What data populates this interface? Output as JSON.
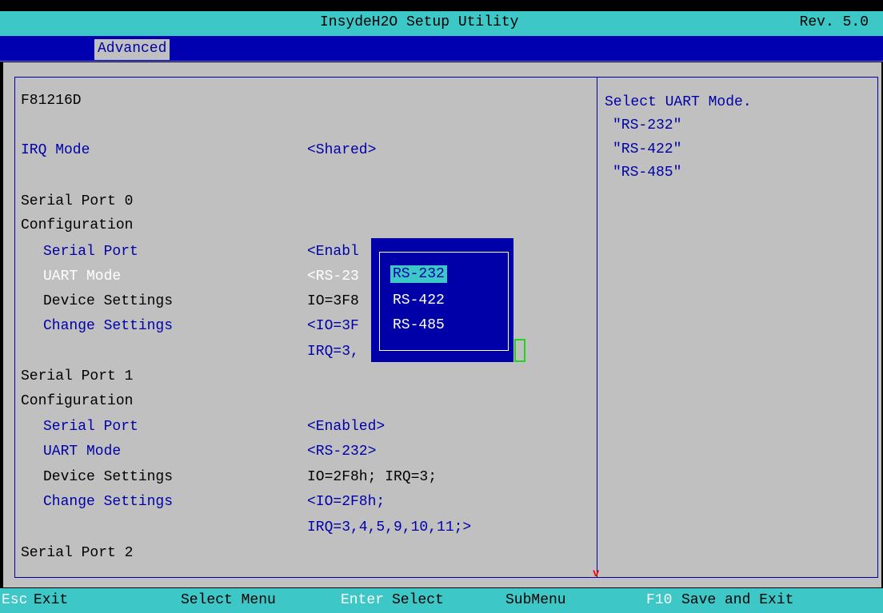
{
  "title": {
    "app": "InsydeH2O Setup Utility",
    "revision": "Rev. 5.0"
  },
  "menu": {
    "tabs": [
      {
        "label": "Advanced",
        "active": true
      }
    ]
  },
  "left": {
    "chip": "F81216D",
    "irq_mode": {
      "label": "IRQ Mode",
      "value": "<Shared>"
    },
    "port0": {
      "title1": "Serial Port 0",
      "title2": "Configuration",
      "serial_port": {
        "label": "Serial Port",
        "value": "<Enabl"
      },
      "uart_mode": {
        "label": "UART Mode",
        "value": "<RS-23"
      },
      "device_settings": {
        "label": "Device Settings",
        "value": "IO=3F8"
      },
      "change_settings": {
        "label": "Change Settings",
        "value": "<IO=3F",
        "value2": "IRQ=3,"
      }
    },
    "port1": {
      "title1": "Serial Port 1",
      "title2": "Configuration",
      "serial_port": {
        "label": "Serial Port",
        "value": "<Enabled>"
      },
      "uart_mode": {
        "label": "UART Mode",
        "value": "<RS-232>"
      },
      "device_settings": {
        "label": "Device Settings",
        "value": "IO=2F8h; IRQ=3;"
      },
      "change_settings": {
        "label": "Change Settings",
        "value": "<IO=2F8h;",
        "value2": "IRQ=3,4,5,9,10,11;>"
      }
    },
    "port2": {
      "title1": "Serial Port 2"
    }
  },
  "help": {
    "lines": [
      "Select UART Mode.",
      "\"RS-232\"",
      "\"RS-422\"",
      "\"RS-485\""
    ]
  },
  "popup": {
    "options": [
      "RS-232",
      "RS-422",
      "RS-485"
    ],
    "selected": "RS-232"
  },
  "scroll_indicator": "v",
  "footer": {
    "esc_key": "Esc",
    "esc_label": "Exit",
    "select_menu": "Select Menu",
    "enter_key": "Enter",
    "enter_label": "Select",
    "submenu": "SubMenu",
    "f10_key": "F10",
    "f10_label": "Save and Exit"
  },
  "colors": {
    "title_bg": "#3ec7c7",
    "menu_bg": "#0000b0",
    "content_bg": "#c0c0c0",
    "selectable_text": "#0000a8",
    "highlight_text": "#ffffff",
    "popup_bg": "#0000a8",
    "popup_active_bg": "#3ec7c7",
    "scroll_indicator": "#ff0000",
    "focus_box": "#22d422"
  }
}
